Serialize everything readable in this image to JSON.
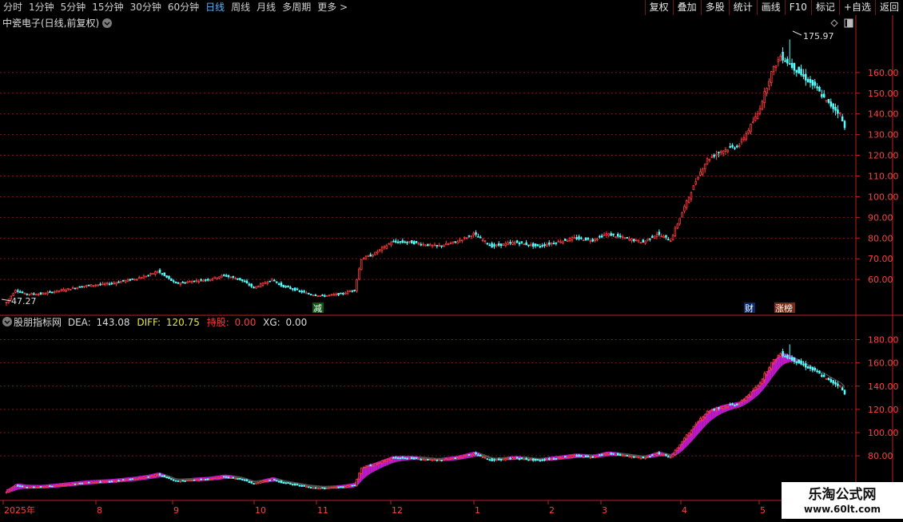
{
  "toolbar": {
    "tabs": [
      "分时",
      "1分钟",
      "5分钟",
      "15分钟",
      "30分钟",
      "60分钟",
      "日线",
      "周线",
      "月线",
      "多周期",
      "更多 >"
    ],
    "active_tab": "日线",
    "buttons": [
      "复权",
      "叠加",
      "多股",
      "统计",
      "画线",
      "F10",
      "标记",
      "+自选",
      "返回"
    ]
  },
  "chart_header": {
    "title": "中瓷电子(日线,前复权)"
  },
  "price_labels": {
    "high": "175.97",
    "low": "47.27"
  },
  "event_tags": [
    "减",
    "财",
    "涨榜"
  ],
  "indicator_header": {
    "name": "股朋指标网",
    "dea_label": "DEA:",
    "dea_value": "143.08",
    "diff_label": "DIFF:",
    "diff_value": "120.75",
    "hold_label": "持股:",
    "hold_value": "0.00",
    "xg_label": "XG:",
    "xg_value": "0.00"
  },
  "x_axis": {
    "labels": [
      "2025年",
      "8",
      "9",
      "10",
      "11",
      "12",
      "1",
      "2",
      "3",
      "4",
      "5"
    ]
  },
  "watermark": {
    "name": "乐淘公式网",
    "url": "www.60lt.com"
  },
  "colors": {
    "up": "#ff3c3c",
    "down": "#54ffff",
    "axis": "#c02020",
    "grid": "#7a1a1a",
    "band": "#c61bd4",
    "band_dark": "#555555",
    "active_tab": "#58b4ff"
  },
  "chart_data": [
    {
      "type": "candlestick",
      "name": "main",
      "y_axis_ticks": [
        60,
        70,
        80,
        90,
        100,
        110,
        120,
        130,
        140,
        150,
        160
      ],
      "y_range": [
        45,
        180
      ],
      "anchors": [
        [
          0,
          49
        ],
        [
          4,
          55
        ],
        [
          8,
          53
        ],
        [
          15,
          53
        ],
        [
          25,
          55
        ],
        [
          35,
          57
        ],
        [
          45,
          58
        ],
        [
          55,
          60
        ],
        [
          62,
          62
        ],
        [
          66,
          64
        ],
        [
          70,
          61
        ],
        [
          74,
          58
        ],
        [
          80,
          59
        ],
        [
          88,
          60
        ],
        [
          95,
          62
        ],
        [
          102,
          60
        ],
        [
          108,
          56
        ],
        [
          112,
          58
        ],
        [
          116,
          60
        ],
        [
          120,
          57
        ],
        [
          126,
          55
        ],
        [
          132,
          53
        ],
        [
          138,
          52
        ],
        [
          146,
          53
        ],
        [
          152,
          55
        ],
        [
          155,
          70
        ],
        [
          160,
          72
        ],
        [
          168,
          78
        ],
        [
          176,
          78
        ],
        [
          188,
          76
        ],
        [
          196,
          78
        ],
        [
          204,
          82
        ],
        [
          212,
          76
        ],
        [
          222,
          78
        ],
        [
          232,
          76
        ],
        [
          240,
          78
        ],
        [
          248,
          80
        ],
        [
          256,
          79
        ],
        [
          262,
          82
        ],
        [
          270,
          80
        ],
        [
          278,
          78
        ],
        [
          284,
          82
        ],
        [
          290,
          79
        ],
        [
          296,
          95
        ],
        [
          302,
          110
        ],
        [
          306,
          118
        ],
        [
          312,
          122
        ],
        [
          320,
          125
        ],
        [
          328,
          140
        ],
        [
          334,
          160
        ],
        [
          338,
          168
        ],
        [
          342,
          164
        ],
        [
          348,
          158
        ],
        [
          354,
          152
        ],
        [
          358,
          146
        ],
        [
          364,
          140
        ],
        [
          366,
          133
        ]
      ],
      "extremes": [
        {
          "bar": 342,
          "value": 175.97
        },
        {
          "bar": 0,
          "value": 47.27
        }
      ]
    },
    {
      "type": "area",
      "name": "indicator",
      "y_axis_ticks": [
        80,
        100,
        120,
        140,
        160,
        180
      ],
      "y_range": [
        45,
        190
      ],
      "series": [
        {
          "name": "DEA",
          "last": 143.08
        },
        {
          "name": "DIFF",
          "last": 120.75
        }
      ]
    }
  ]
}
